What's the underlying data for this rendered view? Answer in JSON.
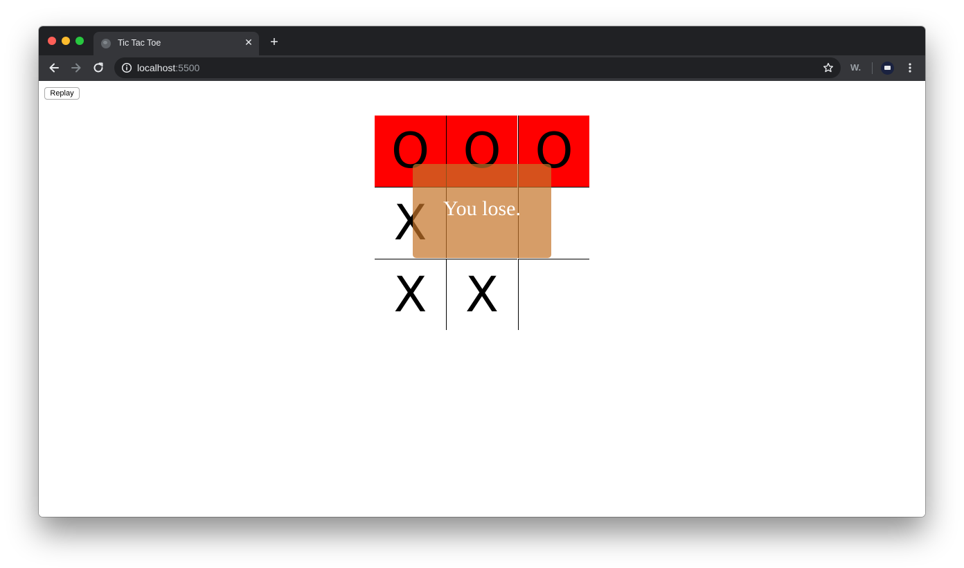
{
  "browser": {
    "tab_title": "Tic Tac Toe",
    "tab_close_glyph": "✕",
    "new_tab_glyph": "+",
    "url_host": "localhost",
    "url_port": ":5500",
    "extension_label": "W."
  },
  "page": {
    "replay_label": "Replay",
    "board": {
      "cells": [
        "O",
        "O",
        "O",
        "X",
        "",
        "",
        "X",
        "X",
        ""
      ],
      "winning_cells": [
        0,
        1,
        2
      ],
      "winning_color": "#ff0000"
    },
    "result_message": "You lose.",
    "result_overlay_color": "#c47428"
  }
}
